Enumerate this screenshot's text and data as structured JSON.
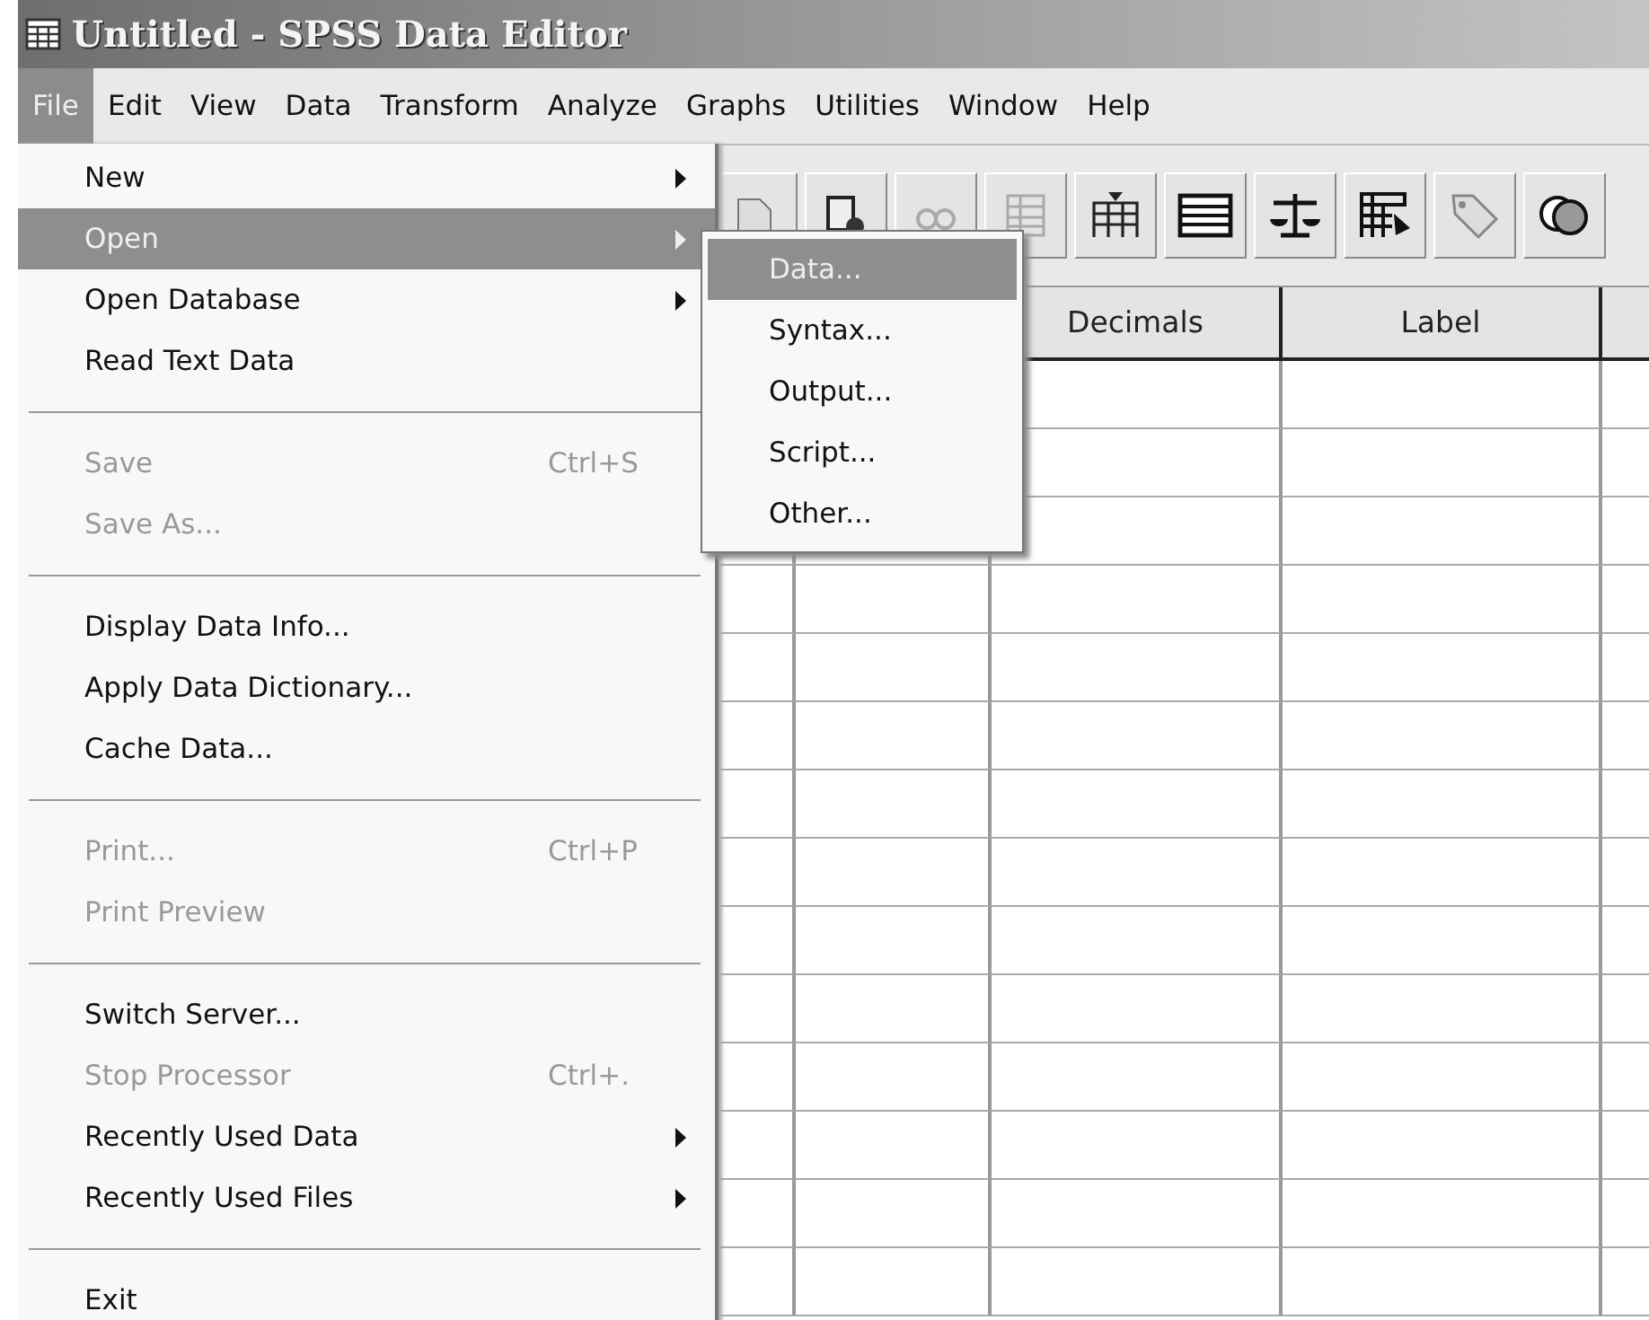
{
  "window": {
    "title": "Untitled - SPSS Data Editor"
  },
  "menu_bar": [
    {
      "label": "File",
      "selected": true
    },
    {
      "label": "Edit",
      "selected": false
    },
    {
      "label": "View",
      "selected": false
    },
    {
      "label": "Data",
      "selected": false
    },
    {
      "label": "Transform",
      "selected": false
    },
    {
      "label": "Analyze",
      "selected": false
    },
    {
      "label": "Graphs",
      "selected": false
    },
    {
      "label": "Utilities",
      "selected": false
    },
    {
      "label": "Window",
      "selected": false
    },
    {
      "label": "Help",
      "selected": false
    }
  ],
  "file_menu": [
    {
      "kind": "item",
      "label": "New",
      "submenu": true,
      "disabled": false,
      "selected": false
    },
    {
      "kind": "item",
      "label": "Open",
      "submenu": true,
      "disabled": false,
      "selected": true
    },
    {
      "kind": "item",
      "label": "Open Database",
      "submenu": true,
      "disabled": false,
      "selected": false
    },
    {
      "kind": "item",
      "label": "Read Text Data",
      "submenu": false,
      "disabled": false,
      "selected": false
    },
    {
      "kind": "separator"
    },
    {
      "kind": "item",
      "label": "Save",
      "shortcut": "Ctrl+S",
      "submenu": false,
      "disabled": true,
      "selected": false
    },
    {
      "kind": "item",
      "label": "Save As...",
      "submenu": false,
      "disabled": true,
      "selected": false
    },
    {
      "kind": "separator"
    },
    {
      "kind": "item",
      "label": "Display Data Info...",
      "submenu": false,
      "disabled": false,
      "selected": false
    },
    {
      "kind": "item",
      "label": "Apply Data Dictionary...",
      "submenu": false,
      "disabled": false,
      "selected": false
    },
    {
      "kind": "item",
      "label": "Cache Data...",
      "submenu": false,
      "disabled": false,
      "selected": false
    },
    {
      "kind": "separator"
    },
    {
      "kind": "item",
      "label": "Print...",
      "shortcut": "Ctrl+P",
      "submenu": false,
      "disabled": true,
      "selected": false
    },
    {
      "kind": "item",
      "label": "Print Preview",
      "submenu": false,
      "disabled": true,
      "selected": false
    },
    {
      "kind": "separator"
    },
    {
      "kind": "item",
      "label": "Switch Server...",
      "submenu": false,
      "disabled": false,
      "selected": false
    },
    {
      "kind": "item",
      "label": "Stop Processor",
      "shortcut": "Ctrl+.",
      "submenu": false,
      "disabled": true,
      "selected": false
    },
    {
      "kind": "item",
      "label": "Recently Used Data",
      "submenu": true,
      "disabled": false,
      "selected": false
    },
    {
      "kind": "item",
      "label": "Recently Used Files",
      "submenu": true,
      "disabled": false,
      "selected": false
    },
    {
      "kind": "separator"
    },
    {
      "kind": "item",
      "label": "Exit",
      "submenu": false,
      "disabled": false,
      "selected": false
    }
  ],
  "open_submenu": [
    {
      "label": "Data...",
      "selected": true
    },
    {
      "label": "Syntax...",
      "selected": false
    },
    {
      "label": "Output...",
      "selected": false
    },
    {
      "label": "Script...",
      "selected": false
    },
    {
      "label": "Other...",
      "selected": false
    }
  ],
  "grid": {
    "columns": [
      {
        "label": "Decimals"
      },
      {
        "label": "Label"
      }
    ]
  }
}
